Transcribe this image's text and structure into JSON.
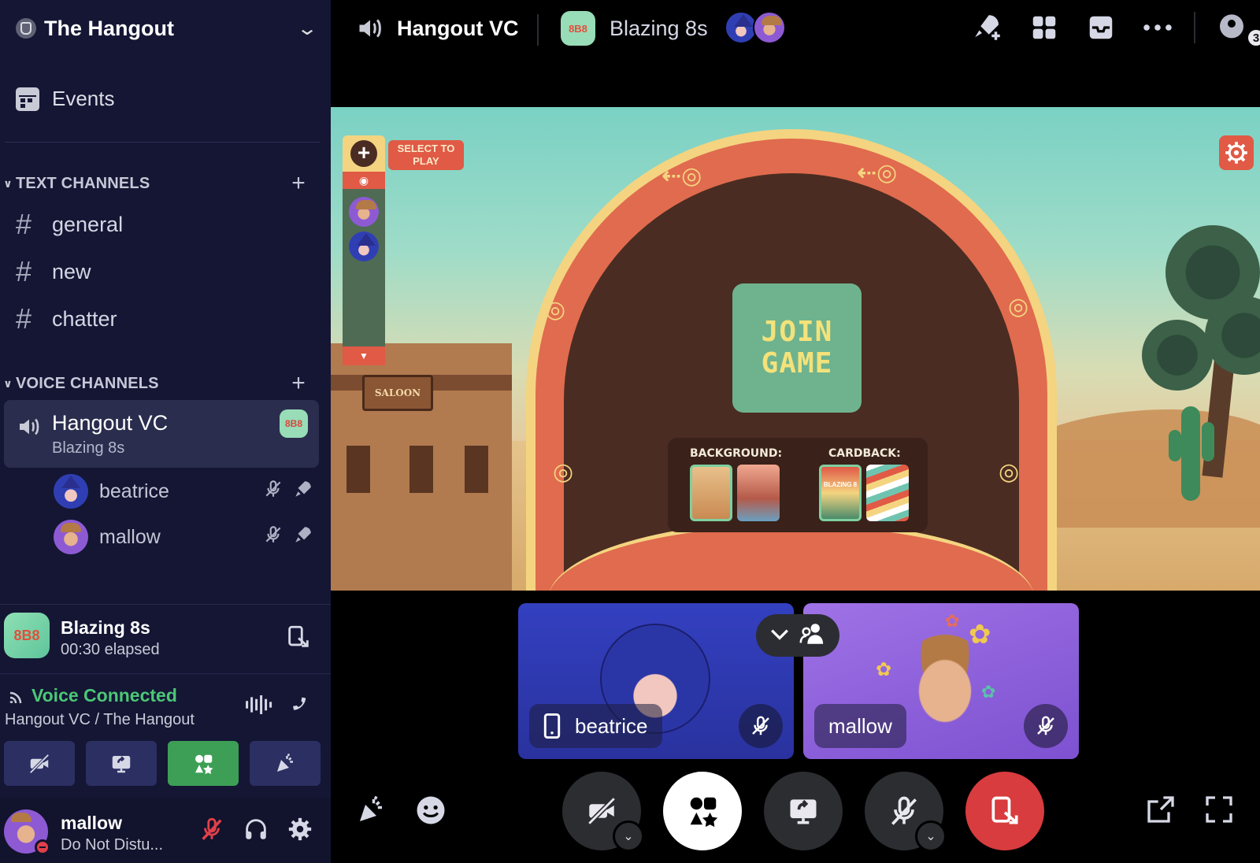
{
  "server": {
    "name": "The Hangout"
  },
  "sidebar": {
    "events_label": "Events",
    "text_category": "TEXT CHANNELS",
    "text_channels": [
      {
        "name": "general"
      },
      {
        "name": "new"
      },
      {
        "name": "chatter"
      }
    ],
    "voice_category": "VOICE CHANNELS",
    "voice_channel": {
      "name": "Hangout VC",
      "activity": "Blazing 8s",
      "badge": "8B8",
      "members": [
        {
          "name": "beatrice"
        },
        {
          "name": "mallow"
        }
      ]
    }
  },
  "activity_panel": {
    "logo": "8B8",
    "title": "Blazing 8s",
    "elapsed": "00:30 elapsed"
  },
  "voice_panel": {
    "status": "Voice Connected",
    "location": "Hangout VC / The Hangout"
  },
  "user_panel": {
    "name": "mallow",
    "status": "Do Not Distu..."
  },
  "topbar": {
    "channel": "Hangout VC",
    "game_logo": "8B8",
    "game": "Blazing 8s",
    "people_count": "3"
  },
  "game": {
    "select_tip": "SELECT TO PLAY",
    "join_line1": "JOIN",
    "join_line2": "GAME",
    "background_label": "BACKGROUND:",
    "cardback_label": "CARDBACK:",
    "saloon_sign": "SALOON",
    "cardback_text": "BLAZING 8"
  },
  "tiles": [
    {
      "name": "beatrice",
      "device": "mobile"
    },
    {
      "name": "mallow"
    }
  ],
  "colors": {
    "sidebar_bg": "#141634",
    "voice_connected": "#4cc776",
    "activity_active": "#3d9f55",
    "leave_red": "#d83c3e",
    "tile_beatrice": "#3340c0",
    "tile_mallow": "#9f72e6",
    "join_green": "#6fb38e"
  },
  "icons": [
    "shield-icon",
    "chevron-down-icon",
    "calendar-icon",
    "hash-icon",
    "plus-icon",
    "speaker-icon",
    "mute-icon",
    "rocket-icon",
    "leave-activity-icon",
    "signal-icon",
    "waveform-icon",
    "hangup-icon",
    "camera-off-icon",
    "screen-share-icon",
    "activity-icon",
    "soundboard-icon",
    "headphones-icon",
    "gear-icon",
    "rocket-plus-icon",
    "grid-icon",
    "inbox-icon",
    "more-icon",
    "people-icon",
    "emoji-icon",
    "popout-icon",
    "fullscreen-icon",
    "eye-icon",
    "mobile-icon"
  ]
}
